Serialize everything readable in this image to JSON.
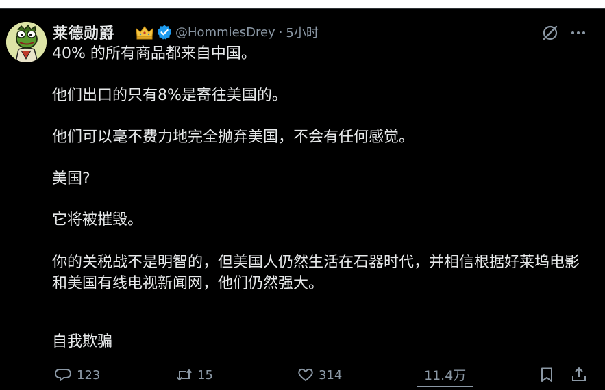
{
  "post": {
    "author": {
      "display_name": "莱德勋爵",
      "handle": "@HommiesDrey",
      "separator": "·",
      "time_ago": "5小时",
      "avatar_icon": "frog-character-avatar",
      "badge_icon": "crown-icon",
      "verified_icon": "verified-badge-icon",
      "verified_color": "#1d9bf0"
    },
    "paragraphs": [
      "40% 的所有商品都来自中国。",
      "他们出口的只有8%是寄往美国的。",
      "他们可以毫不费力地完全抛弃美国，不会有任何感觉。",
      "美国?",
      "它将被摧毁。",
      "你的关税战不是明智的，但美国人仍然生活在石器时代，并相信根据好莱坞电影和美国有线电视新闻网，他们仍然强大。",
      "自我欺骗"
    ],
    "actions": {
      "replies": "123",
      "reposts": "15",
      "likes": "314",
      "views": "11.4万"
    }
  }
}
